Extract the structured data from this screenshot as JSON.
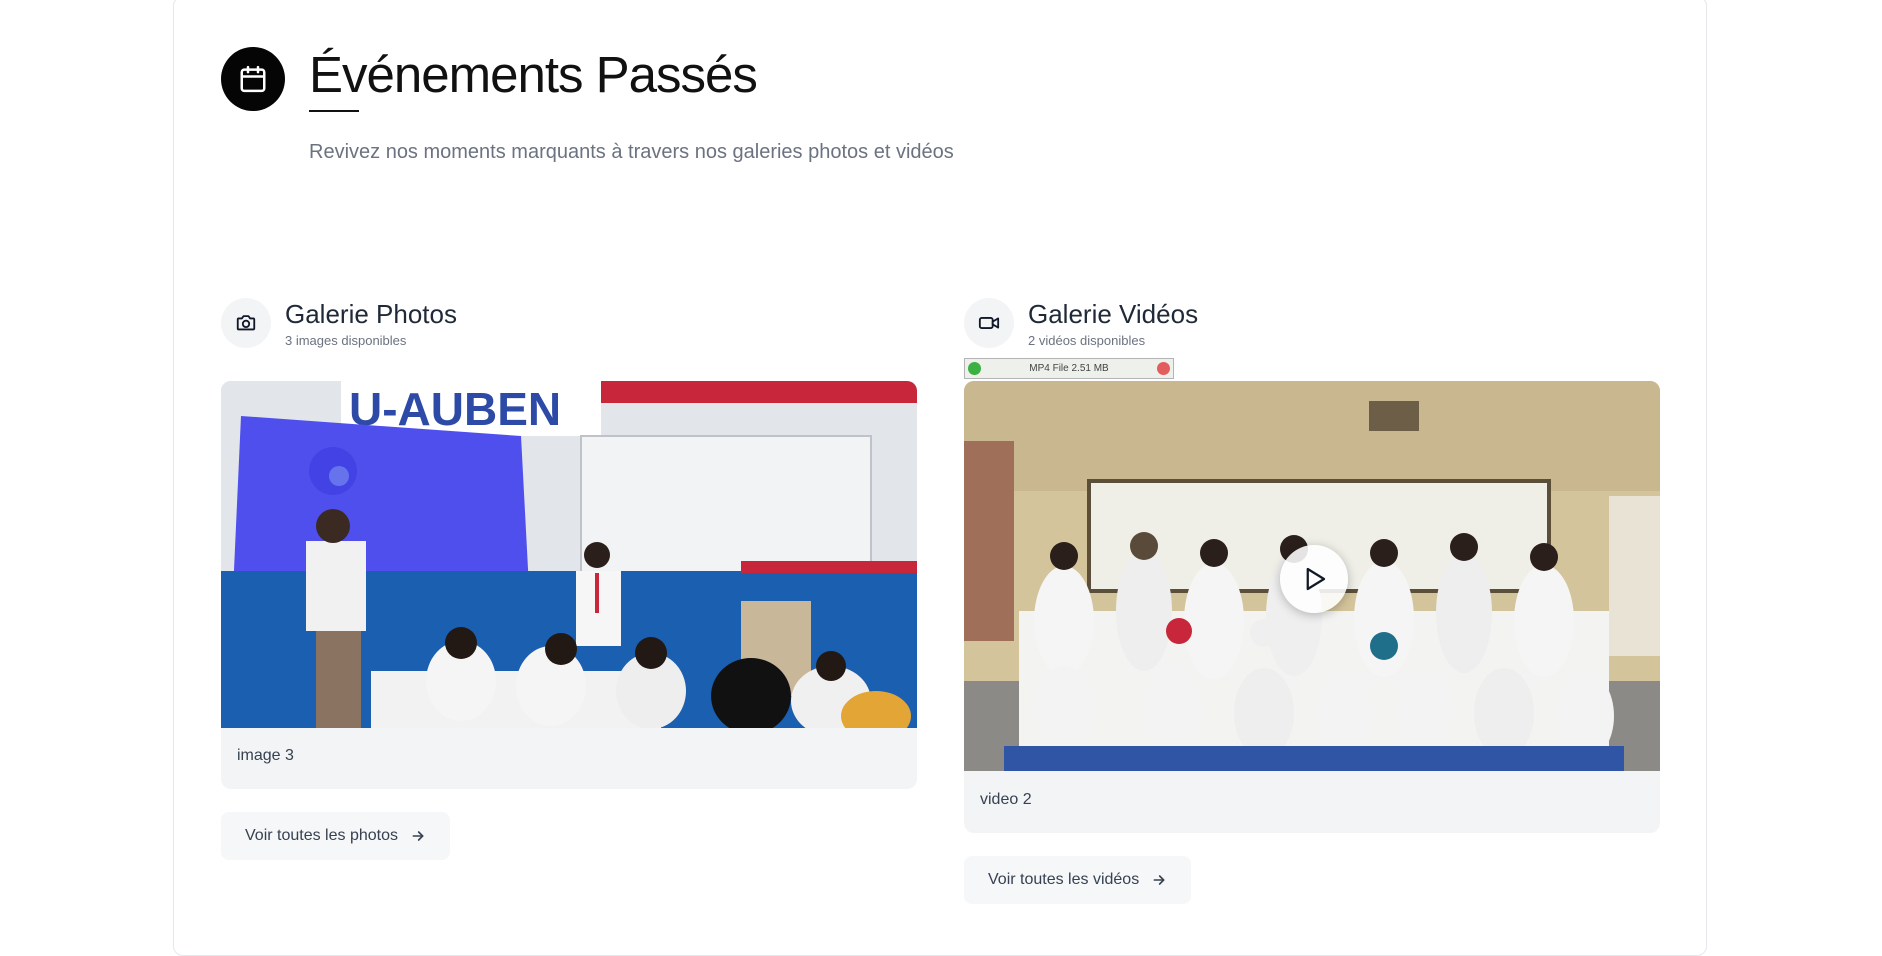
{
  "header": {
    "title": "Événements Passés",
    "subtitle": "Revivez nos moments marquants à travers nos galeries photos et vidéos",
    "icon": "calendar-icon"
  },
  "photos": {
    "title": "Galerie Photos",
    "count_label": "3 images disponibles",
    "icon": "camera-icon",
    "card_caption": "image 3",
    "image_banner_text": "U-AUBEN",
    "view_all_label": "Voir toutes les photos"
  },
  "videos": {
    "title": "Galerie Vidéos",
    "count_label": "2 vidéos disponibles",
    "icon": "video-icon",
    "card_caption": "video 2",
    "view_all_label": "Voir toutes les vidéos",
    "file_badge": "MP4 File 2.51 MB"
  },
  "colors": {
    "accent": "#050505",
    "card_bg": "#f3f4f6",
    "muted_text": "#6b7280"
  }
}
